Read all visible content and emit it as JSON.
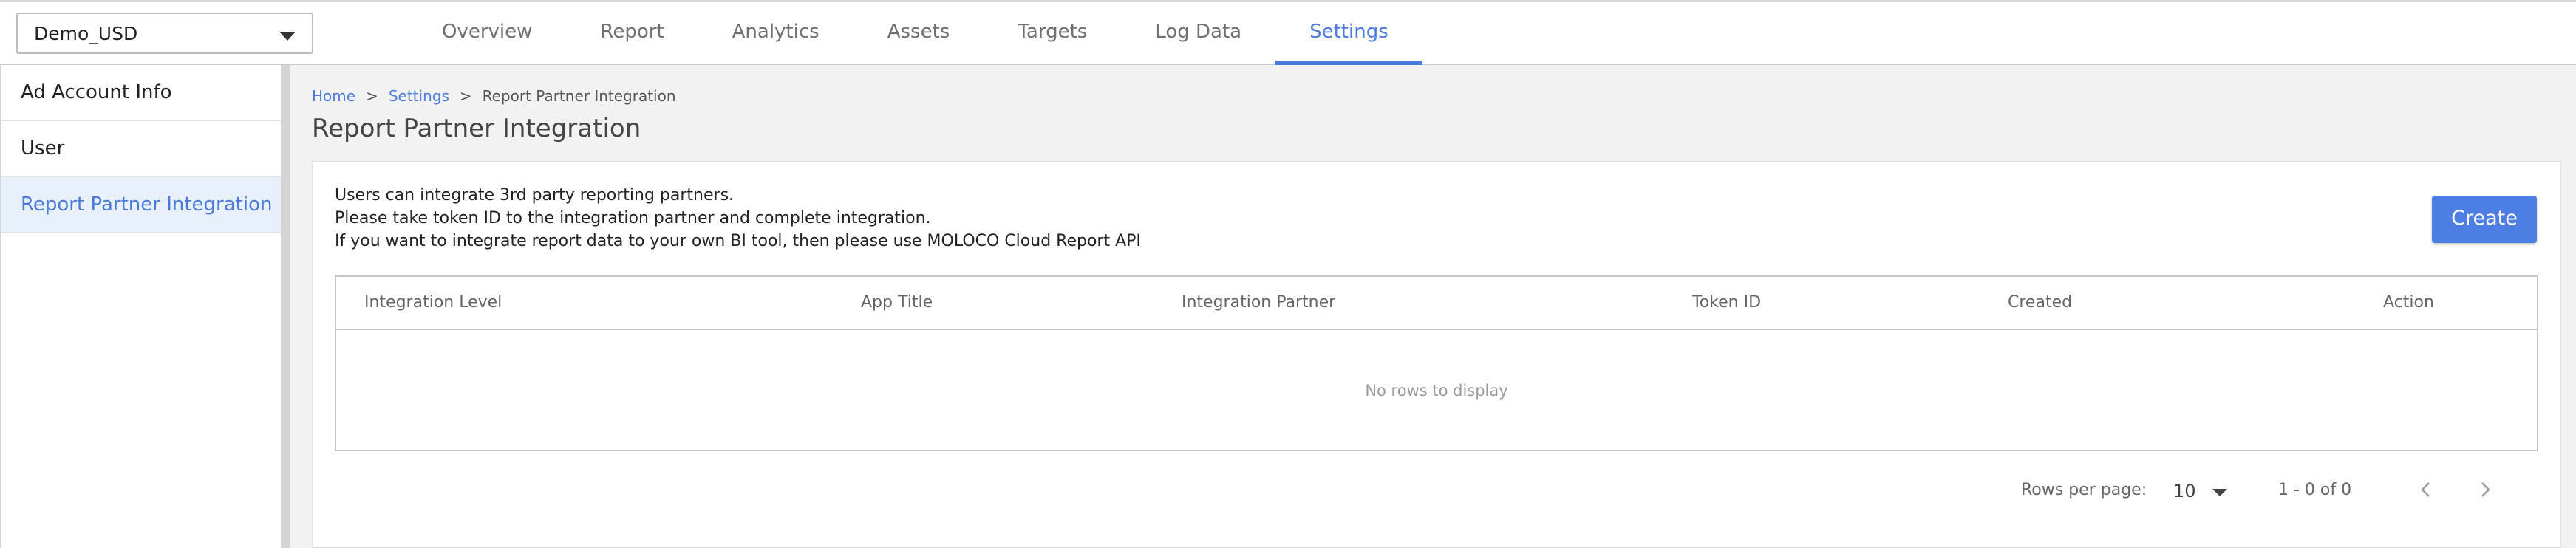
{
  "account_selector": {
    "value": "Demo_USD",
    "icon": "chevron-down-icon"
  },
  "tabs": [
    {
      "label": "Overview"
    },
    {
      "label": "Report"
    },
    {
      "label": "Analytics"
    },
    {
      "label": "Assets"
    },
    {
      "label": "Targets"
    },
    {
      "label": "Log Data"
    },
    {
      "label": "Settings",
      "active": true
    }
  ],
  "sidebar": {
    "items": [
      {
        "label": "Ad Account Info"
      },
      {
        "label": "User"
      },
      {
        "label": "Report Partner Integration",
        "active": true
      }
    ]
  },
  "breadcrumb": {
    "home": "Home",
    "settings": "Settings",
    "current": "Report Partner Integration",
    "separator": ">"
  },
  "page_title": "Report Partner Integration",
  "description": {
    "line1": "Users can integrate 3rd party reporting partners.",
    "line2": "Please take token ID to the integration partner and complete integration.",
    "line3": "If you want to integrate report data to your own BI tool, then please use MOLOCO Cloud Report API"
  },
  "create_button": "Create",
  "table": {
    "columns": [
      "Integration Level",
      "App Title",
      "Integration Partner",
      "Token ID",
      "Created",
      "Action"
    ],
    "empty_text": "No rows to display"
  },
  "pagination": {
    "rows_per_page_label": "Rows per page:",
    "rows_per_page_value": "10",
    "range_text": "1 - 0 of 0",
    "prev_icon": "chevron-left-icon",
    "next_icon": "chevron-right-icon"
  },
  "colors": {
    "accent": "#4d7bdc",
    "active_side_bg": "#e8f0fc",
    "page_bg": "#f2f2f2"
  }
}
